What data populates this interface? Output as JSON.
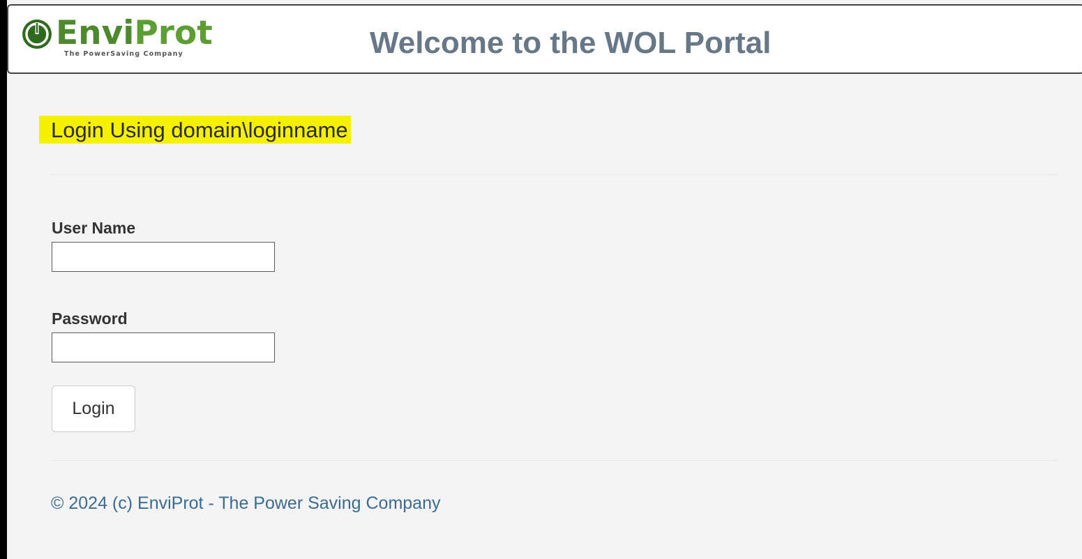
{
  "header": {
    "logo": {
      "word_part1": "Envi",
      "word_part2": "Prot",
      "tagline": "The PowerSaving Company",
      "brand_color": "#4e8a2d"
    },
    "title": "Welcome to the WOL Portal"
  },
  "login": {
    "heading": "Login Using domain\\loginname",
    "heading_highlight_color": "#f5ef00",
    "username": {
      "label": "User Name",
      "value": ""
    },
    "password": {
      "label": "Password",
      "value": ""
    },
    "submit_label": "Login"
  },
  "footer": {
    "text": "© 2024 (c) EnviProt - The Power Saving Company",
    "link_color": "#3a6c92"
  }
}
